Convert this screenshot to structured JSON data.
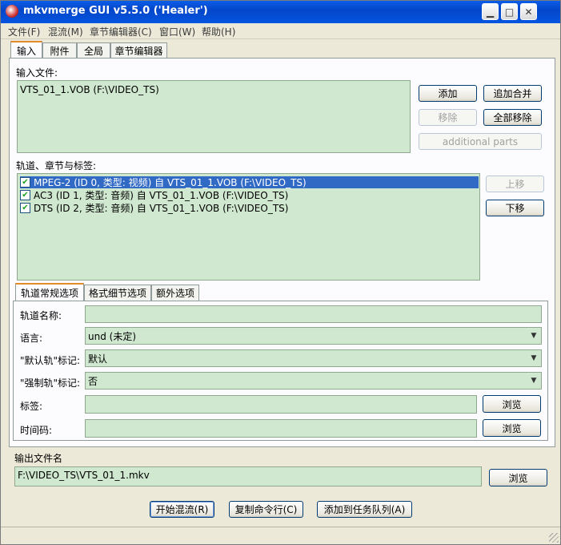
{
  "window": {
    "title": "mkvmerge GUI v5.5.0 ('Healer')",
    "controls": {
      "minimize": "▁",
      "maximize": "□",
      "close": "✕"
    }
  },
  "menu": [
    "文件(F)",
    "混流(M)",
    "章节编辑器(C)",
    "窗口(W)",
    "帮助(H)"
  ],
  "main_tabs": [
    "输入",
    "附件",
    "全局",
    "章节编辑器"
  ],
  "input": {
    "files_label": "输入文件:",
    "files": [
      "VTS_01_1.VOB (F:\\VIDEO_TS)"
    ],
    "buttons": {
      "add": "添加",
      "append": "追加合并",
      "remove": "移除",
      "remove_all": "全部移除",
      "additional_parts": "additional parts"
    },
    "tracks_label": "轨道、章节与标签:",
    "tracks": [
      {
        "checked": true,
        "text": "MPEG-2 (ID 0, 类型: 视频) 自 VTS_01_1.VOB (F:\\VIDEO_TS)",
        "selected": true
      },
      {
        "checked": true,
        "text": "AC3 (ID 1, 类型: 音频) 自 VTS_01_1.VOB (F:\\VIDEO_TS)",
        "selected": false
      },
      {
        "checked": true,
        "text": "DTS (ID 2, 类型: 音频) 自 VTS_01_1.VOB (F:\\VIDEO_TS)",
        "selected": false
      }
    ],
    "move_up": "上移",
    "move_down": "下移"
  },
  "sub_tabs": [
    "轨道常规选项",
    "格式细节选项",
    "额外选项"
  ],
  "track_options": {
    "name_label": "轨道名称:",
    "name_value": "",
    "language_label": "语言:",
    "language_value": "und (未定)",
    "default_label": "\"默认轨\"标记:",
    "default_value": "默认",
    "forced_label": "\"强制轨\"标记:",
    "forced_value": "否",
    "tags_label": "标签:",
    "tags_value": "",
    "timecodes_label": "时间码:",
    "timecodes_value": "",
    "browse": "浏览"
  },
  "output": {
    "label": "输出文件名",
    "value": "F:\\VIDEO_TS\\VTS_01_1.mkv",
    "browse": "浏览"
  },
  "actions": {
    "start": "开始混流(R)",
    "copy_cmd": "复制命令行(C)",
    "add_queue": "添加到任务队列(A)"
  }
}
